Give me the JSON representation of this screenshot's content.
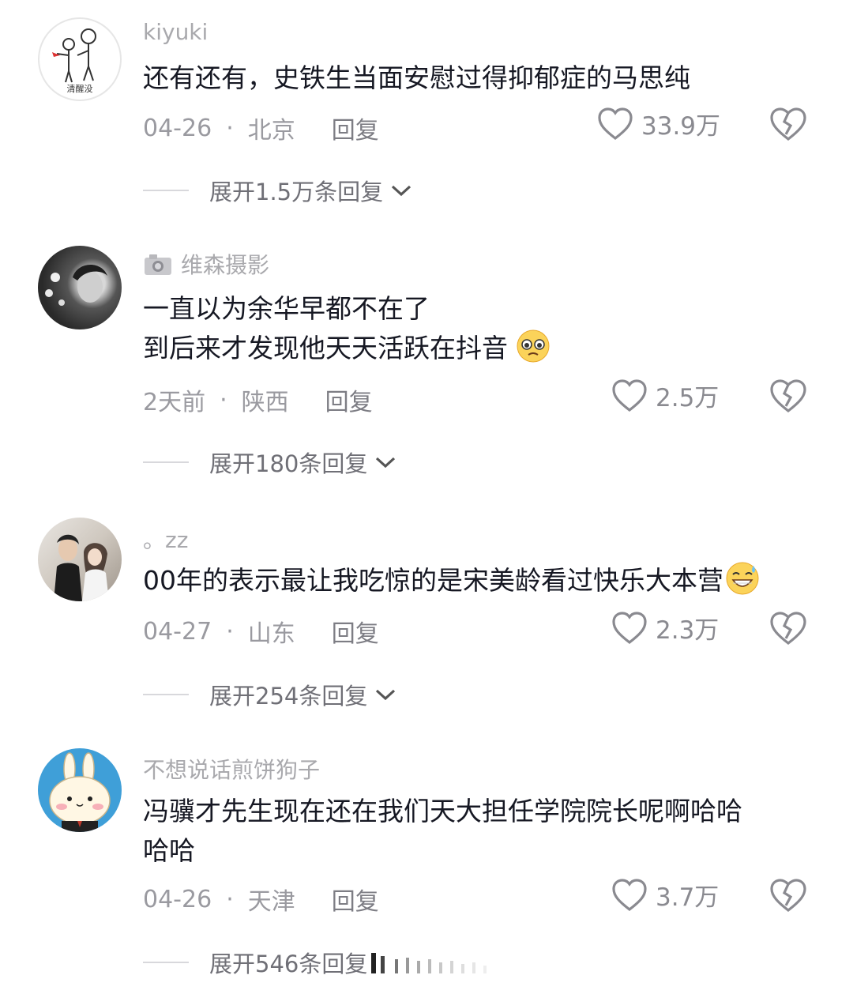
{
  "comments": [
    {
      "username": "kiyuki",
      "avatar_caption": "清醒没",
      "lines": [
        "还有还有，史铁生当面安慰过得抑郁症的马思纯"
      ],
      "date": "04-26",
      "location": "北京",
      "reply_label": "回复",
      "likes": "33.9万",
      "expand_label": "展开1.5万条回复"
    },
    {
      "username": "维森摄影",
      "lines": [
        "一直以为余华早都不在了",
        "到后来才发现他天天活跃在抖音"
      ],
      "emoji": "pleading-face",
      "date": "2天前",
      "location": "陕西",
      "reply_label": "回复",
      "likes": "2.5万",
      "expand_label": "展开180条回复"
    },
    {
      "username": "。zz",
      "lines": [
        "00年的表示最让我吃惊的是宋美龄看过快乐大本营"
      ],
      "emoji": "grinning-sweat-face",
      "date": "04-27",
      "location": "山东",
      "reply_label": "回复",
      "likes": "2.3万",
      "expand_label": "展开254条回复"
    },
    {
      "username": "不想说话煎饼狗子",
      "lines": [
        "冯骥才先生现在还在我们天大担任学院院长呢啊哈哈",
        "哈哈"
      ],
      "date": "04-26",
      "location": "天津",
      "reply_label": "回复",
      "likes": "3.7万",
      "expand_label": "展开546条回复"
    }
  ],
  "colors": {
    "text": "#161823",
    "muted": "#9a9aa0",
    "icon": "#8a8a90"
  }
}
